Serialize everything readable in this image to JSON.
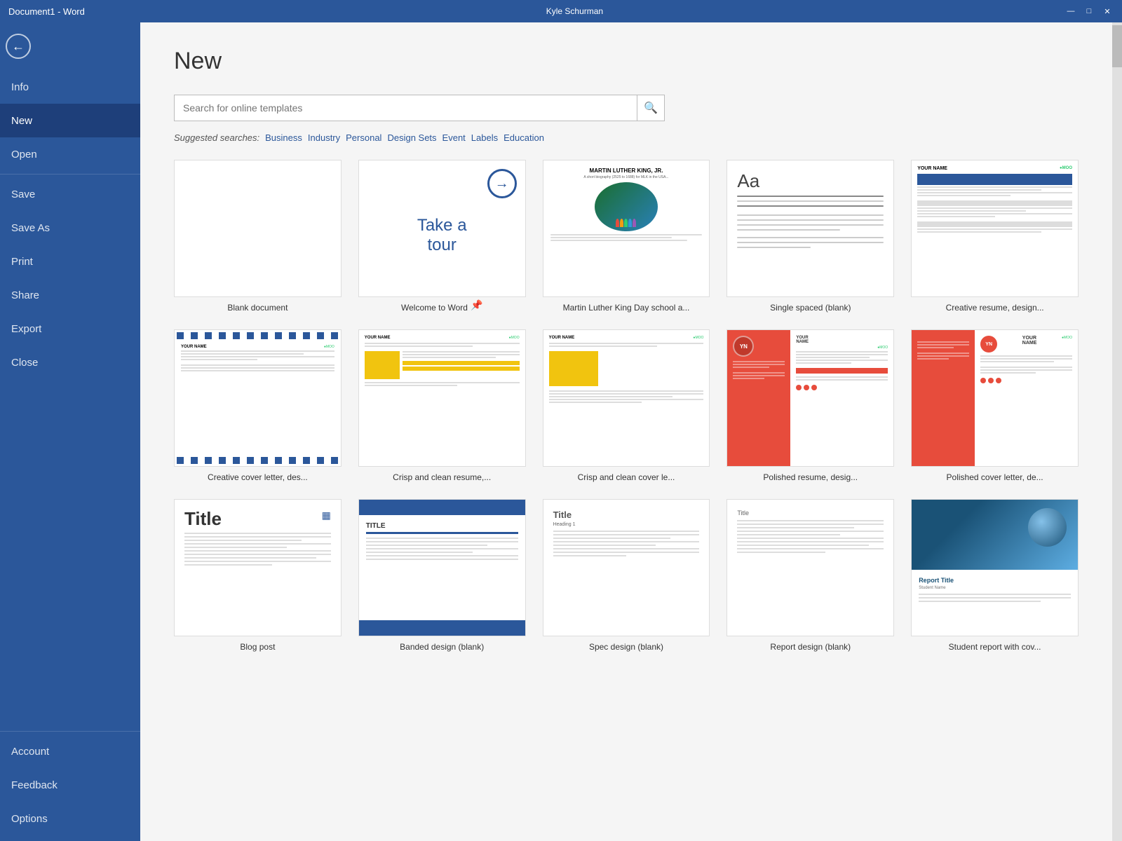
{
  "titlebar": {
    "title": "Document1 - Word",
    "user": "Kyle Schurman",
    "minimize_label": "—",
    "maximize_label": "□",
    "close_label": "✕"
  },
  "sidebar": {
    "back_label": "←",
    "items": [
      {
        "id": "info",
        "label": "Info",
        "active": false
      },
      {
        "id": "new",
        "label": "New",
        "active": true
      },
      {
        "id": "open",
        "label": "Open",
        "active": false
      },
      {
        "id": "save",
        "label": "Save",
        "active": false
      },
      {
        "id": "save-as",
        "label": "Save As",
        "active": false
      },
      {
        "id": "print",
        "label": "Print",
        "active": false
      },
      {
        "id": "share",
        "label": "Share",
        "active": false
      },
      {
        "id": "export",
        "label": "Export",
        "active": false
      },
      {
        "id": "close",
        "label": "Close",
        "active": false
      }
    ],
    "bottom_items": [
      {
        "id": "account",
        "label": "Account"
      },
      {
        "id": "feedback",
        "label": "Feedback"
      },
      {
        "id": "options",
        "label": "Options"
      }
    ]
  },
  "main": {
    "page_title": "New",
    "search_placeholder": "Search for online templates",
    "suggested_label": "Suggested searches:",
    "suggested_links": [
      "Business",
      "Industry",
      "Personal",
      "Design Sets",
      "Event",
      "Labels",
      "Education"
    ],
    "templates": [
      {
        "id": "blank",
        "label": "Blank document",
        "type": "blank"
      },
      {
        "id": "tour",
        "label": "Welcome to Word",
        "type": "tour"
      },
      {
        "id": "mlk",
        "label": "Martin Luther King Day school a...",
        "type": "mlk"
      },
      {
        "id": "single-spaced",
        "label": "Single spaced (blank)",
        "type": "single-spaced"
      },
      {
        "id": "creative-resume",
        "label": "Creative resume, design...",
        "type": "resume"
      },
      {
        "id": "cover-letter",
        "label": "Creative cover letter, des...",
        "type": "cover1"
      },
      {
        "id": "crisp-resume",
        "label": "Crisp and clean resume,...",
        "type": "cover2"
      },
      {
        "id": "crisp-cover",
        "label": "Crisp and clean cover le...",
        "type": "cover3"
      },
      {
        "id": "polished-resume",
        "label": "Polished resume, desig...",
        "type": "polished1"
      },
      {
        "id": "polished-cover",
        "label": "Polished cover letter, de...",
        "type": "polished2"
      },
      {
        "id": "blog",
        "label": "Blog post",
        "type": "blog"
      },
      {
        "id": "banded",
        "label": "Banded design (blank)",
        "type": "banded"
      },
      {
        "id": "spec",
        "label": "Spec design (blank)",
        "type": "spec"
      },
      {
        "id": "report",
        "label": "Report design (blank)",
        "type": "report"
      },
      {
        "id": "student-report",
        "label": "Student report with cov...",
        "type": "student"
      }
    ]
  }
}
